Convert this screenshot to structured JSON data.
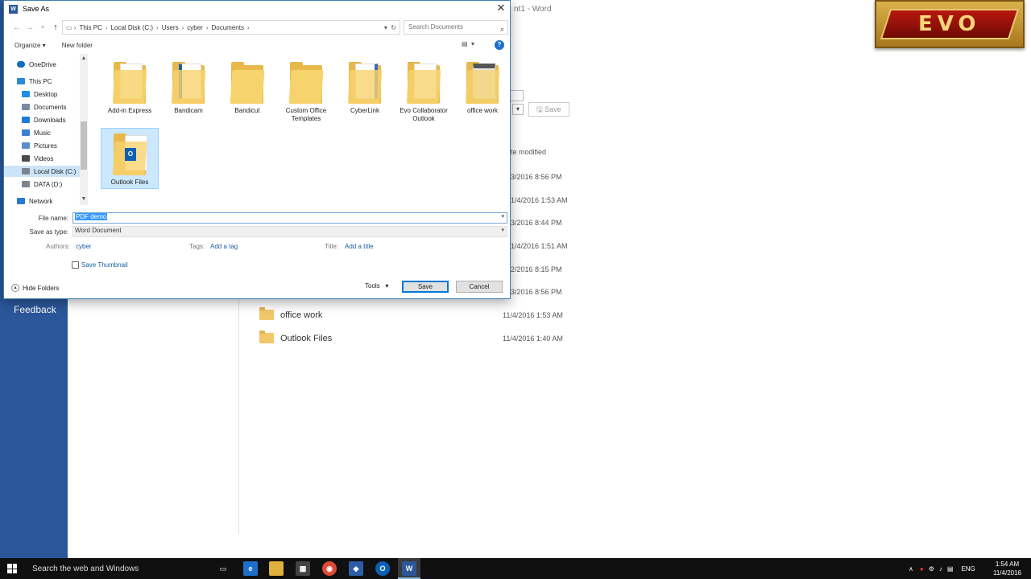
{
  "word": {
    "title_fragment": "nt1 - Word",
    "feedback": "Feedback",
    "save_button": "Save",
    "date_header": "te modified",
    "dates": [
      "3/2016 8:56 PM",
      "1/4/2016 1:53 AM",
      "3/2016 8:44 PM",
      "1/4/2016 1:51 AM",
      "2/2016 8:15 PM",
      "3/2016 8:56 PM"
    ],
    "files": [
      {
        "name": "office work",
        "date": "11/4/2016 1:53 AM"
      },
      {
        "name": "Outlook Files",
        "date": "11/4/2016 1:40 AM"
      }
    ]
  },
  "logo_text": "EVO",
  "dialog": {
    "title": "Save As",
    "close": "✕",
    "breadcrumb": [
      "This PC",
      "Local Disk (C:)",
      "Users",
      "cyber",
      "Documents"
    ],
    "search_placeholder": "Search Documents",
    "organize": "Organize ▾",
    "new_folder": "New folder",
    "help": "?",
    "nav": [
      {
        "label": "OneDrive",
        "color": "#0f6cbd"
      },
      {
        "label": "This PC",
        "color": "#2b8ad6"
      },
      {
        "label": "Desktop",
        "color": "#1f8fe0"
      },
      {
        "label": "Documents",
        "color": "#7a8aa0"
      },
      {
        "label": "Downloads",
        "color": "#1f7ad6"
      },
      {
        "label": "Music",
        "color": "#3e7fd0"
      },
      {
        "label": "Pictures",
        "color": "#5b8fc7"
      },
      {
        "label": "Videos",
        "color": "#4a4a4a"
      },
      {
        "label": "Local Disk (C:)",
        "color": "#7b8591"
      },
      {
        "label": "DATA (D:)",
        "color": "#7b8591"
      },
      {
        "label": "Network",
        "color": "#2b7ad6"
      }
    ],
    "folders": [
      {
        "name": "Add-in Express"
      },
      {
        "name": "Bandicam"
      },
      {
        "name": "Bandicut"
      },
      {
        "name": "Custom Office Templates"
      },
      {
        "name": "CyberLink"
      },
      {
        "name": "Evo Collaborator Outlook"
      },
      {
        "name": "office work"
      },
      {
        "name": "Outlook Files"
      }
    ],
    "file_name_label": "File name:",
    "file_name_value": "PDF demo",
    "save_type_label": "Save as type:",
    "save_type_value": "Word Document",
    "authors_label": "Authors:",
    "authors_value": "cyber",
    "tags_label": "Tags:",
    "tags_value": "Add a tag",
    "title_label": "Title:",
    "title_value": "Add a title",
    "save_thumbnail": "Save Thumbnail",
    "hide_folders": "Hide Folders",
    "tools": "Tools",
    "save": "Save",
    "cancel": "Cancel"
  },
  "taskbar": {
    "search": "Search the web and Windows",
    "lang": "ENG",
    "time": "1:54 AM",
    "date": "11/4/2016"
  }
}
